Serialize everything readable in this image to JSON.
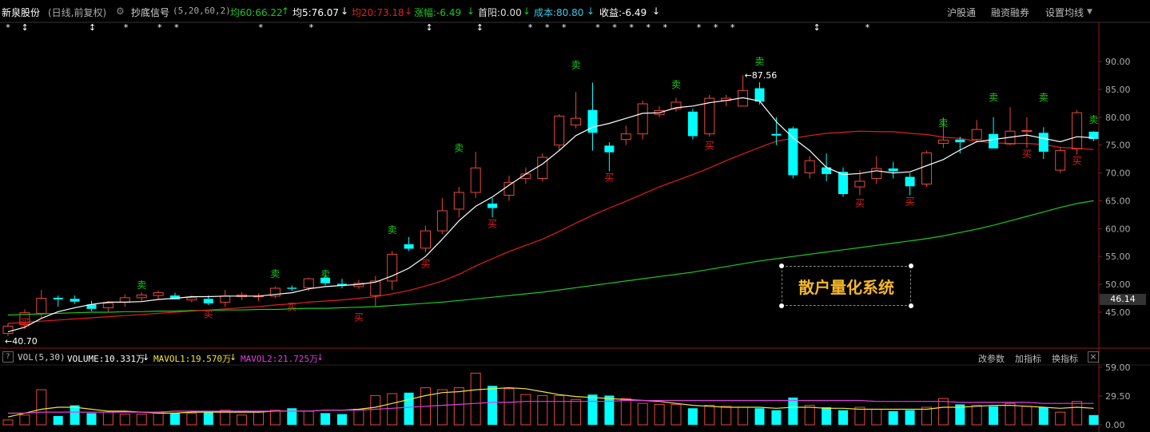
{
  "header": {
    "stock_name": "新泉股份",
    "period": "(日线,前复权)",
    "indicator_name": "抄底信号",
    "indicator_params": "(5,20,60,2)",
    "ma60": "均60:66.22",
    "ma5": "均5:76.07",
    "ma20": "均20:73.18",
    "change": "涨幅:-6.49",
    "first_limit": "首阳:0.00",
    "cost": "成本:80.80",
    "profit": "收益:-6.49",
    "buttons": [
      "沪股通",
      "融资融券",
      "设置均线"
    ],
    "colors": {
      "ma60": "#1ec81e",
      "ma5": "#ffffff",
      "ma20": "#e0201e",
      "change": "#1ec81e",
      "cost": "#3cc8e6",
      "profit": "#ffffff"
    }
  },
  "main_chart": {
    "y_ticks": [
      "90.00",
      "85.00",
      "80.00",
      "75.00",
      "70.00",
      "65.00",
      "60.00",
      "55.00",
      "50.00",
      "45.00"
    ],
    "y_values": [
      90,
      85,
      80,
      75,
      70,
      65,
      60,
      55,
      50,
      45
    ],
    "current_price_tag": "46.14",
    "high_label": "87.56",
    "low_label": "40.70",
    "watermark": "散户量化系统",
    "buy_label": "买",
    "sell_label": "卖"
  },
  "volume_panel": {
    "help": "?",
    "title": "VOL(5,30)",
    "volume": "VOLUME:10.331万",
    "mavol1": "MAVOL1:19.570万",
    "mavol2": "MAVOL2:21.725万",
    "buttons": [
      "改参数",
      "加指标",
      "换指标"
    ],
    "close": "×",
    "y_ticks": [
      "59.00",
      "29.50",
      "0.00"
    ],
    "y_values": [
      59,
      29.5,
      0
    ]
  },
  "chart_data": {
    "type": "candlestick",
    "ylim": [
      42,
      92
    ],
    "volume_ylim": [
      0,
      59
    ],
    "candles": [
      {
        "o": 41.2,
        "h": 43.0,
        "l": 40.7,
        "c": 42.5,
        "v": 5
      },
      {
        "o": 42.8,
        "h": 45.5,
        "l": 42.0,
        "c": 44.9,
        "v": 10
      },
      {
        "o": 44.8,
        "h": 49.0,
        "l": 44.0,
        "c": 47.5,
        "v": 36
      },
      {
        "o": 47.6,
        "h": 48.0,
        "l": 46.0,
        "c": 47.3,
        "v": 9
      },
      {
        "o": 47.4,
        "h": 48.0,
        "l": 46.5,
        "c": 46.9,
        "v": 20
      },
      {
        "o": 46.4,
        "h": 47.0,
        "l": 45.2,
        "c": 45.6,
        "v": 12
      },
      {
        "o": 45.8,
        "h": 47.0,
        "l": 45.0,
        "c": 46.6,
        "v": 13
      },
      {
        "o": 46.8,
        "h": 48.2,
        "l": 46.0,
        "c": 47.6,
        "v": 11
      },
      {
        "o": 47.6,
        "h": 48.6,
        "l": 47.0,
        "c": 48.1,
        "v": 11
      },
      {
        "o": 48.0,
        "h": 48.9,
        "l": 47.2,
        "c": 48.5,
        "v": 13
      },
      {
        "o": 48.0,
        "h": 48.5,
        "l": 47.4,
        "c": 47.3,
        "v": 12
      },
      {
        "o": 47.2,
        "h": 48.0,
        "l": 46.8,
        "c": 47.6,
        "v": 12
      },
      {
        "o": 47.4,
        "h": 48.0,
        "l": 46.3,
        "c": 46.6,
        "v": 14
      },
      {
        "o": 46.8,
        "h": 49.0,
        "l": 46.0,
        "c": 47.9,
        "v": 15
      },
      {
        "o": 47.8,
        "h": 48.6,
        "l": 47.2,
        "c": 48.1,
        "v": 10
      },
      {
        "o": 47.8,
        "h": 48.4,
        "l": 47.0,
        "c": 47.9,
        "v": 13
      },
      {
        "o": 47.9,
        "h": 49.6,
        "l": 47.5,
        "c": 49.3,
        "v": 15
      },
      {
        "o": 49.4,
        "h": 49.8,
        "l": 48.8,
        "c": 49.2,
        "v": 17
      },
      {
        "o": 49.4,
        "h": 51.2,
        "l": 48.8,
        "c": 51.0,
        "v": 14
      },
      {
        "o": 51.2,
        "h": 51.6,
        "l": 49.8,
        "c": 50.2,
        "v": 12
      },
      {
        "o": 50.1,
        "h": 51.0,
        "l": 49.3,
        "c": 49.8,
        "v": 11
      },
      {
        "o": 49.6,
        "h": 50.8,
        "l": 49.2,
        "c": 50.2,
        "v": 16
      },
      {
        "o": 48.0,
        "h": 51.5,
        "l": 46.0,
        "c": 50.6,
        "v": 30
      },
      {
        "o": 50.6,
        "h": 56.0,
        "l": 49.0,
        "c": 55.4,
        "v": 32
      },
      {
        "o": 57.2,
        "h": 58.5,
        "l": 56.0,
        "c": 56.4,
        "v": 33
      },
      {
        "o": 56.5,
        "h": 60.5,
        "l": 55.8,
        "c": 59.6,
        "v": 38
      },
      {
        "o": 59.6,
        "h": 65.5,
        "l": 59.0,
        "c": 63.2,
        "v": 36
      },
      {
        "o": 63.5,
        "h": 67.5,
        "l": 62.0,
        "c": 66.5,
        "v": 38
      },
      {
        "o": 66.5,
        "h": 73.8,
        "l": 65.5,
        "c": 70.9,
        "v": 53
      },
      {
        "o": 64.5,
        "h": 65.5,
        "l": 62.0,
        "c": 63.7,
        "v": 40
      },
      {
        "o": 66.0,
        "h": 69.5,
        "l": 65.0,
        "c": 68.3,
        "v": 37
      },
      {
        "o": 69.0,
        "h": 71.0,
        "l": 68.0,
        "c": 69.8,
        "v": 31
      },
      {
        "o": 69.0,
        "h": 73.5,
        "l": 68.5,
        "c": 72.8,
        "v": 30
      },
      {
        "o": 75.0,
        "h": 80.5,
        "l": 74.0,
        "c": 80.2,
        "v": 30
      },
      {
        "o": 78.6,
        "h": 84.5,
        "l": 78.0,
        "c": 79.8,
        "v": 26
      },
      {
        "o": 81.3,
        "h": 86.2,
        "l": 74.0,
        "c": 77.2,
        "v": 31
      },
      {
        "o": 74.9,
        "h": 75.5,
        "l": 70.3,
        "c": 73.7,
        "v": 30
      },
      {
        "o": 76.0,
        "h": 78.5,
        "l": 75.0,
        "c": 77.0,
        "v": 27
      },
      {
        "o": 77.0,
        "h": 83.0,
        "l": 76.0,
        "c": 82.4,
        "v": 22
      },
      {
        "o": 80.5,
        "h": 82.0,
        "l": 80.0,
        "c": 81.2,
        "v": 21
      },
      {
        "o": 81.5,
        "h": 83.5,
        "l": 81.0,
        "c": 82.7,
        "v": 21
      },
      {
        "o": 81.0,
        "h": 81.5,
        "l": 76.0,
        "c": 76.6,
        "v": 17
      },
      {
        "o": 77.0,
        "h": 84.0,
        "l": 76.5,
        "c": 83.4,
        "v": 20
      },
      {
        "o": 83.0,
        "h": 84.0,
        "l": 82.0,
        "c": 83.4,
        "v": 19
      },
      {
        "o": 82.0,
        "h": 87.56,
        "l": 82.0,
        "c": 84.8,
        "v": 18
      },
      {
        "o": 85.2,
        "h": 86.3,
        "l": 82.3,
        "c": 82.8,
        "v": 17
      },
      {
        "o": 77.0,
        "h": 80.0,
        "l": 75.0,
        "c": 76.7,
        "v": 15
      },
      {
        "o": 78.0,
        "h": 78.3,
        "l": 69.0,
        "c": 69.6,
        "v": 28
      },
      {
        "o": 70.0,
        "h": 73.0,
        "l": 69.0,
        "c": 72.2,
        "v": 20
      },
      {
        "o": 71.0,
        "h": 73.5,
        "l": 68.5,
        "c": 69.8,
        "v": 18
      },
      {
        "o": 70.2,
        "h": 71.0,
        "l": 65.7,
        "c": 66.2,
        "v": 15
      },
      {
        "o": 67.5,
        "h": 70.5,
        "l": 66.0,
        "c": 68.5,
        "v": 18
      },
      {
        "o": 69.0,
        "h": 73.0,
        "l": 68.0,
        "c": 70.8,
        "v": 16
      },
      {
        "o": 70.8,
        "h": 72.0,
        "l": 69.0,
        "c": 70.3,
        "v": 14
      },
      {
        "o": 69.3,
        "h": 70.0,
        "l": 66.0,
        "c": 67.6,
        "v": 15
      },
      {
        "o": 68.0,
        "h": 74.0,
        "l": 67.5,
        "c": 73.6,
        "v": 18
      },
      {
        "o": 75.3,
        "h": 80.0,
        "l": 74.5,
        "c": 75.9,
        "v": 27
      },
      {
        "o": 76.0,
        "h": 76.5,
        "l": 73.5,
        "c": 75.5,
        "v": 21
      },
      {
        "o": 76.0,
        "h": 79.5,
        "l": 75.5,
        "c": 77.8,
        "v": 20
      },
      {
        "o": 77.0,
        "h": 80.0,
        "l": 74.5,
        "c": 74.4,
        "v": 19
      },
      {
        "o": 75.2,
        "h": 81.8,
        "l": 75.0,
        "c": 77.5,
        "v": 22
      },
      {
        "o": 77.6,
        "h": 80.0,
        "l": 74.5,
        "c": 77.6,
        "v": 19
      },
      {
        "o": 77.2,
        "h": 78.2,
        "l": 72.5,
        "c": 73.8,
        "v": 18
      },
      {
        "o": 70.5,
        "h": 74.5,
        "l": 70.0,
        "c": 74.0,
        "v": 13
      },
      {
        "o": 74.3,
        "h": 81.3,
        "l": 73.3,
        "c": 80.8,
        "v": 24
      },
      {
        "o": 77.4,
        "h": 77.5,
        "l": 75.7,
        "c": 76.1,
        "v": 10
      }
    ],
    "ma5": [
      41.5,
      42.3,
      43.9,
      45.1,
      45.8,
      46.4,
      46.8,
      46.8,
      46.9,
      47.3,
      47.5,
      47.8,
      47.8,
      47.9,
      47.9,
      47.9,
      48.2,
      48.5,
      49.2,
      49.6,
      49.8,
      50.0,
      50.4,
      51.5,
      52.9,
      55.0,
      58.1,
      61.4,
      64.0,
      65.7,
      67.8,
      69.8,
      71.6,
      74.0,
      76.7,
      78.2,
      78.9,
      79.8,
      80.7,
      80.8,
      81.7,
      82.0,
      82.6,
      83.0,
      83.5,
      82.9,
      79.2,
      76.3,
      74.0,
      71.0,
      69.7,
      69.9,
      70.4,
      70.0,
      70.2,
      71.3,
      72.4,
      74.1,
      75.6,
      76.0,
      76.4,
      76.8,
      76.2,
      75.6,
      76.5,
      76.3
    ],
    "ma20": [
      43.0,
      43.2,
      43.4,
      43.6,
      43.8,
      44.0,
      44.2,
      44.4,
      44.6,
      44.8,
      45.0,
      45.2,
      45.4,
      45.6,
      45.8,
      46.0,
      46.3,
      46.5,
      46.8,
      47.0,
      47.2,
      47.5,
      47.8,
      48.3,
      48.9,
      49.7,
      50.6,
      51.8,
      53.3,
      54.6,
      55.9,
      57.0,
      58.1,
      59.5,
      61.0,
      62.4,
      63.7,
      64.9,
      66.2,
      67.5,
      68.6,
      69.7,
      70.9,
      72.2,
      73.4,
      74.6,
      75.7,
      76.2,
      76.7,
      77.1,
      77.3,
      77.5,
      77.4,
      77.4,
      77.1,
      76.9,
      76.4,
      76.2,
      75.7,
      75.4,
      75.3,
      75.3,
      75.1,
      74.6,
      74.4,
      74.2
    ],
    "ma60": [
      44.5,
      44.6,
      44.7,
      44.8,
      44.9,
      45.0,
      45.0,
      45.1,
      45.1,
      45.2,
      45.2,
      45.3,
      45.3,
      45.4,
      45.4,
      45.5,
      45.5,
      45.6,
      45.7,
      45.7,
      45.8,
      45.9,
      46.0,
      46.2,
      46.4,
      46.6,
      46.8,
      47.1,
      47.4,
      47.7,
      48.0,
      48.3,
      48.6,
      49.0,
      49.4,
      49.8,
      50.2,
      50.6,
      51.0,
      51.4,
      51.8,
      52.2,
      52.7,
      53.2,
      53.7,
      54.2,
      54.6,
      55.0,
      55.4,
      55.8,
      56.2,
      56.6,
      57.0,
      57.4,
      57.8,
      58.2,
      58.7,
      59.3,
      59.9,
      60.6,
      61.4,
      62.2,
      63.0,
      63.8,
      64.5,
      65.0
    ],
    "mavol1": [
      8,
      12,
      16,
      18,
      18,
      16,
      14,
      14,
      13,
      12,
      12,
      13,
      13,
      13,
      13,
      13,
      14,
      14,
      14,
      15,
      15,
      16,
      18,
      22,
      26,
      30,
      33,
      34,
      36,
      37,
      38,
      37,
      34,
      31,
      29,
      28,
      27,
      26,
      25,
      24,
      22,
      20,
      19,
      18,
      18,
      18,
      17,
      18,
      18,
      17,
      17,
      16,
      16,
      16,
      16,
      16,
      18,
      18,
      19,
      20,
      20,
      19,
      18,
      17,
      18,
      17
    ],
    "mavol2": [
      12,
      12,
      13,
      13,
      13,
      13,
      13,
      13,
      13,
      13,
      14,
      14,
      14,
      14,
      14,
      14,
      14,
      14,
      14,
      15,
      15,
      15,
      16,
      17,
      18,
      19,
      20,
      21,
      22,
      23,
      23,
      24,
      24,
      24,
      24,
      24,
      24,
      25,
      25,
      25,
      25,
      25,
      25,
      25,
      25,
      25,
      25,
      25,
      25,
      25,
      25,
      25,
      24,
      24,
      24,
      24,
      24,
      23,
      23,
      23,
      23,
      23,
      22,
      22,
      22,
      22
    ],
    "markers_top": [
      "*",
      "↕",
      "",
      "",
      "",
      "↕",
      "",
      "*",
      "",
      "*",
      "*",
      "",
      "",
      "",
      "",
      "*",
      "",
      "",
      "*",
      "",
      "",
      "",
      "",
      "",
      "",
      "↕",
      "",
      "",
      "↕",
      "",
      "",
      "*",
      "*",
      "*",
      "",
      "*",
      "*",
      "*",
      "*",
      "*",
      "",
      "*",
      "*",
      "*",
      "",
      "",
      "",
      "",
      "↕",
      "",
      "",
      "*",
      "",
      ""
    ],
    "signals": [
      {
        "i": 1,
        "type": "buy",
        "price": 44.3
      },
      {
        "i": 8,
        "type": "sell",
        "price": 49.3
      },
      {
        "i": 12,
        "type": "buy",
        "price": 45.8
      },
      {
        "i": 16,
        "type": "sell",
        "price": 51.3
      },
      {
        "i": 17,
        "type": "buy",
        "price": 47.1
      },
      {
        "i": 19,
        "type": "sell",
        "price": 51.2
      },
      {
        "i": 21,
        "type": "buy",
        "price": 45.2
      },
      {
        "i": 23,
        "type": "sell",
        "price": 59.2
      },
      {
        "i": 25,
        "type": "buy",
        "price": 54.8
      },
      {
        "i": 27,
        "type": "sell",
        "price": 73.9
      },
      {
        "i": 29,
        "type": "buy",
        "price": 62.0
      },
      {
        "i": 34,
        "type": "sell",
        "price": 88.8
      },
      {
        "i": 36,
        "type": "buy",
        "price": 70.3
      },
      {
        "i": 40,
        "type": "sell",
        "price": 85.3
      },
      {
        "i": 42,
        "type": "buy",
        "price": 76.0
      },
      {
        "i": 45,
        "type": "sell",
        "price": 89.4
      },
      {
        "i": 51,
        "type": "buy",
        "price": 65.7
      },
      {
        "i": 54,
        "type": "buy",
        "price": 66.0
      },
      {
        "i": 56,
        "type": "sell",
        "price": 78.4
      },
      {
        "i": 59,
        "type": "sell",
        "price": 83.0
      },
      {
        "i": 61,
        "type": "buy",
        "price": 74.5
      },
      {
        "i": 62,
        "type": "sell",
        "price": 83.0
      },
      {
        "i": 64,
        "type": "buy",
        "price": 73.3
      },
      {
        "i": 65,
        "type": "sell",
        "price": 79.0
      }
    ]
  }
}
